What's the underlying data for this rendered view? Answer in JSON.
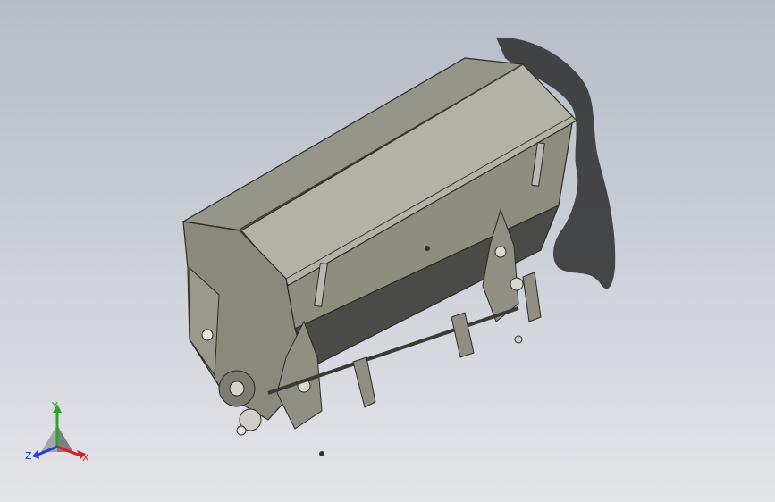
{
  "view_triad": {
    "axis_x": {
      "label": "X",
      "color": "#d62020"
    },
    "axis_y": {
      "label": "Y",
      "color": "#2aa52a"
    },
    "axis_z": {
      "label": "Z",
      "color": "#2a3fd6"
    }
  },
  "colors": {
    "background_top": "#b5bcc8",
    "background_bottom": "#e4e5e9",
    "body_light": "#a3a396",
    "body_mid": "#8c8b7c",
    "body_dark": "#4b4b47",
    "shadow": "#2e2e2e"
  }
}
